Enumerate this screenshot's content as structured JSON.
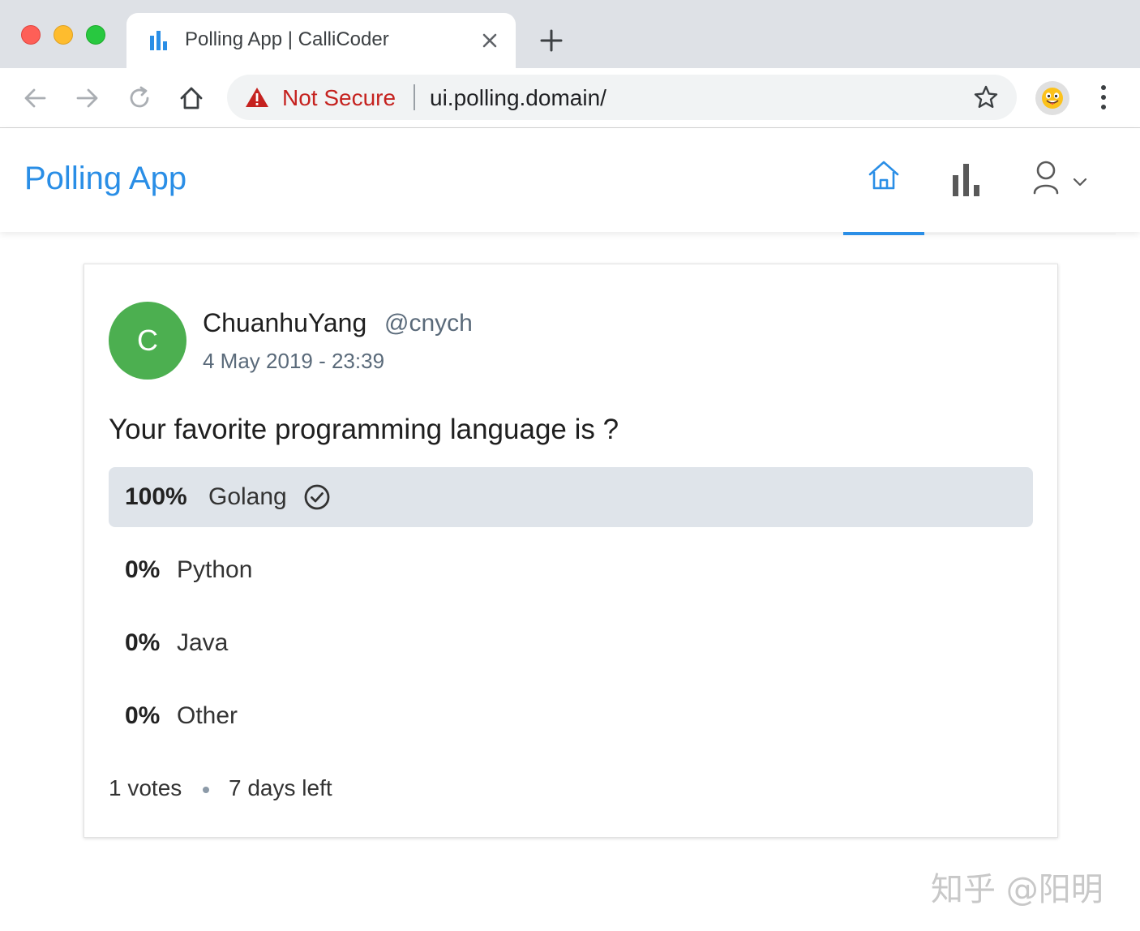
{
  "browser": {
    "tab_title": "Polling App | CalliCoder",
    "security_label": "Not Secure",
    "url": "ui.polling.domain/"
  },
  "header": {
    "brand": "Polling App",
    "active_nav": "home"
  },
  "poll": {
    "creator": {
      "avatar_letter": "C",
      "name": "ChuanhuYang",
      "username": "@cnych",
      "created_at": "4 May 2019 - 23:39"
    },
    "question": "Your favorite programming language is ?",
    "choices": [
      {
        "percent_label": "100%",
        "text": "Golang",
        "fraction": 1.0,
        "selected": true
      },
      {
        "percent_label": "0%",
        "text": "Python",
        "fraction": 0.0,
        "selected": false
      },
      {
        "percent_label": "0%",
        "text": "Java",
        "fraction": 0.0,
        "selected": false
      },
      {
        "percent_label": "0%",
        "text": "Other",
        "fraction": 0.0,
        "selected": false
      }
    ],
    "votes": "1 votes",
    "time_left": "7 days left"
  },
  "watermark": "知乎 @阳明",
  "colors": {
    "accent": "#2a8ee6",
    "avatar": "#4caf50",
    "winner_fill": "#dfe4ea",
    "not_secure": "#c5221f"
  },
  "icons": [
    "bar-chart-favicon-icon",
    "close-icon",
    "plus-icon",
    "back-arrow-icon",
    "forward-arrow-icon",
    "reload-icon",
    "home-icon",
    "warning-icon",
    "star-icon",
    "profile-emoji-icon",
    "kebab-menu-icon",
    "nav-home-icon",
    "nav-poll-icon",
    "nav-user-icon",
    "chevron-down-icon",
    "check-circle-icon"
  ]
}
